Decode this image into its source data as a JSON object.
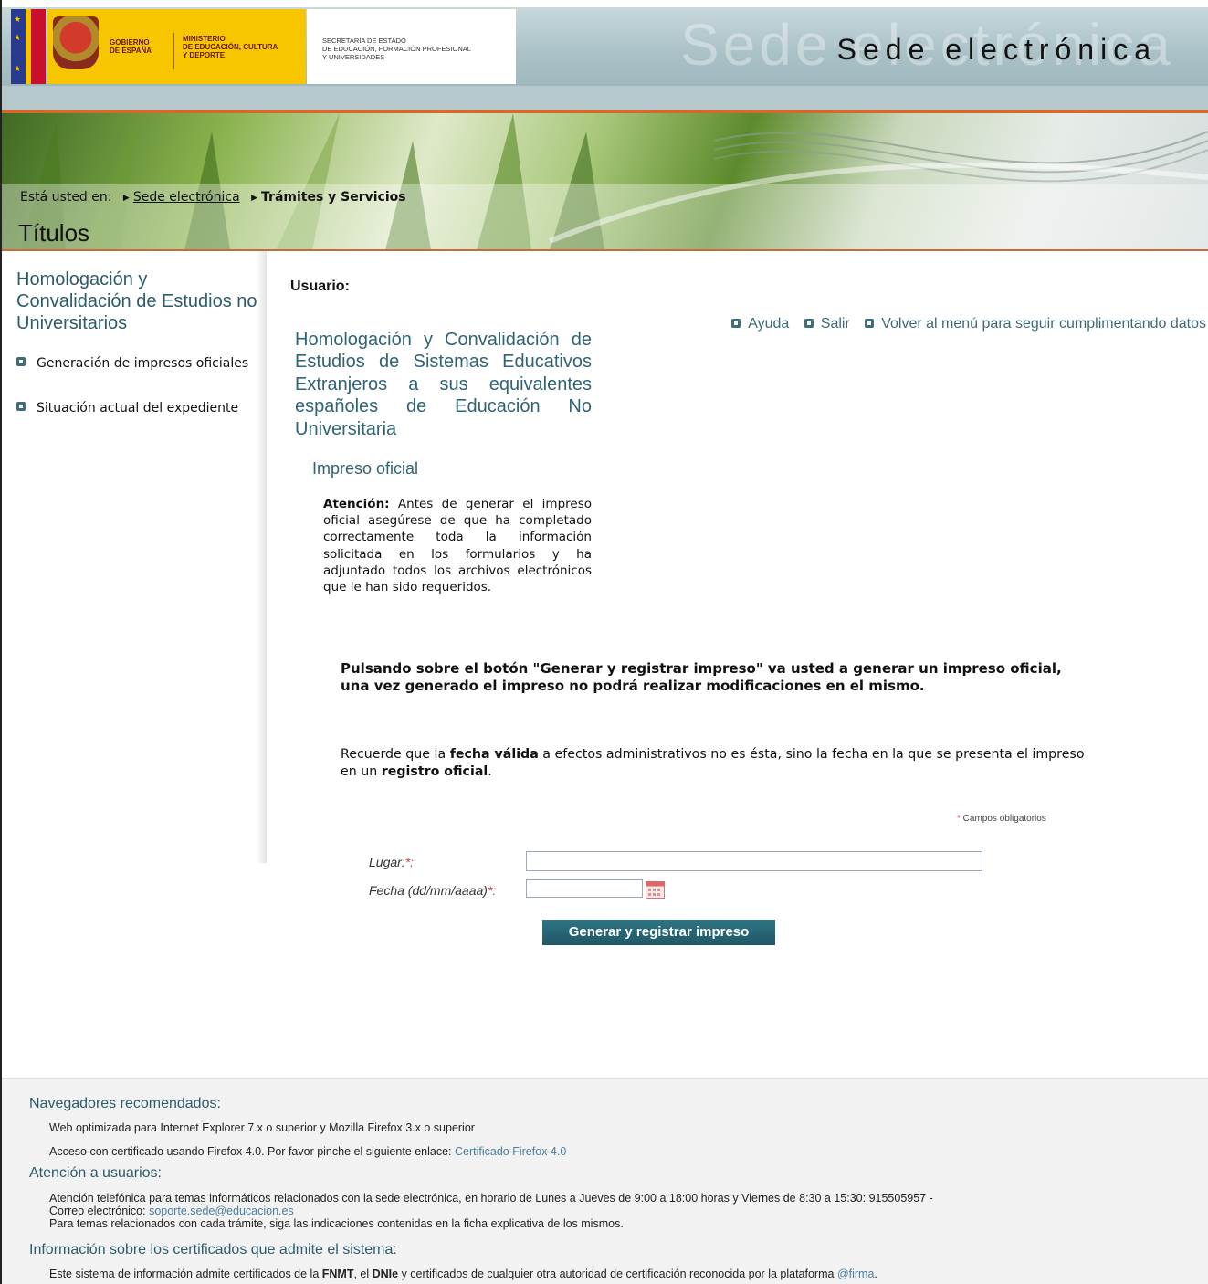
{
  "header": {
    "gov_text_1": "GOBIERNO",
    "gov_text_2": "DE ESPAÑA",
    "ministry_1": "MINISTERIO",
    "ministry_2": "DE EDUCACIÓN, CULTURA",
    "ministry_3": "Y DEPORTE",
    "secretaria_1": "SECRETARÍA DE ESTADO",
    "secretaria_2": "DE EDUCACIÓN, FORMACIÓN PROFESIONAL",
    "secretaria_3": "Y UNIVERSIDADES",
    "sede_ghost": "Sede electrónica",
    "sede_title": "Sede electrónica"
  },
  "breadcrumb": {
    "prefix": "Está usted en:",
    "item_1": "Sede electrónica",
    "item_2": "Trámites y Servicios"
  },
  "page_title": "Títulos",
  "sidebar": {
    "title": "Homologación y Convalidación de Estudios no Universitarios",
    "items": [
      {
        "label": "Generación de impresos oficiales"
      },
      {
        "label": "Situación actual del expediente"
      }
    ]
  },
  "main": {
    "user_label": "Usuario:",
    "actions": [
      {
        "label": "Ayuda"
      },
      {
        "label": "Salir"
      },
      {
        "label": "Volver al menú para seguir cumplimentando datos"
      }
    ],
    "heading": "Homologación y Convalidación de Estudios de Sistemas Educativos Extranjeros a sus equivalentes españoles de Educación No Universitaria",
    "impreso_title": "Impreso oficial",
    "atencion_bold": "Atención:",
    "atencion_text": " Antes de generar el impreso oficial asegúrese de que ha completado correctamente toda la información solicitada en los formularios y ha adjuntado todos los archivos electrónicos que le han sido requeridos.",
    "pulsando": "Pulsando sobre el botón \"Generar y registrar impreso\" va usted a generar un impreso oficial, una vez generado el impreso no podrá realizar modificaciones en el mismo.",
    "recuerde_1": "Recuerde que la ",
    "recuerde_bold_1": "fecha válida",
    "recuerde_2": " a efectos administrativos no es ésta, sino la fecha en la que se presenta el impreso en un ",
    "recuerde_bold_2": "registro oficial",
    "recuerde_3": ".",
    "campos_star": "*",
    "campos_text": " Campos obligatorios",
    "form": {
      "lugar_label": "Lugar:",
      "lugar_value": "",
      "fecha_label": "Fecha (dd/mm/aaaa)",
      "fecha_value": "",
      "req_mark": "*:"
    },
    "button": "Generar y registrar impreso"
  },
  "footer": {
    "nav_head": "Navegadores recomendados:",
    "nav_1": "Web optimizada para Internet Explorer 7.x o superior y Mozilla Firefox 3.x o superior",
    "nav_2": "Acceso con certificado usando Firefox 4.0. Por favor pinche el siguiente enlace: ",
    "nav_2_link": "Certificado Firefox 4.0",
    "att_head": "Atención a usuarios:",
    "att_1": "Atención telefónica para temas informáticos relacionados con la sede electrónica, en horario de Lunes a Jueves de 9:00 a 18:00 horas y Viernes de 8:30 a 15:30: 915505957 -",
    "att_2": "Correo electrónico: ",
    "att_2_link": "soporte.sede@educacion.es",
    "att_3": "Para temas relacionados con cada trámite, siga las indicaciones contenidas en la ficha explicativa de los mismos.",
    "cert_head": "Información sobre los certificados que admite el sistema:",
    "cert_1a": "Este sistema de información admite certificados de la ",
    "cert_fnmt": "FNMT",
    "cert_1b": ", el ",
    "cert_dnie": "DNIe",
    "cert_1c": " y certificados de cualquier otra autoridad de certificación reconocida por la plataforma ",
    "cert_link": "@firma",
    "cert_1d": "."
  },
  "colors": {
    "accent": "#2e6475",
    "orange": "#d9662a",
    "button": "#1f5766",
    "required": "#d04040"
  }
}
